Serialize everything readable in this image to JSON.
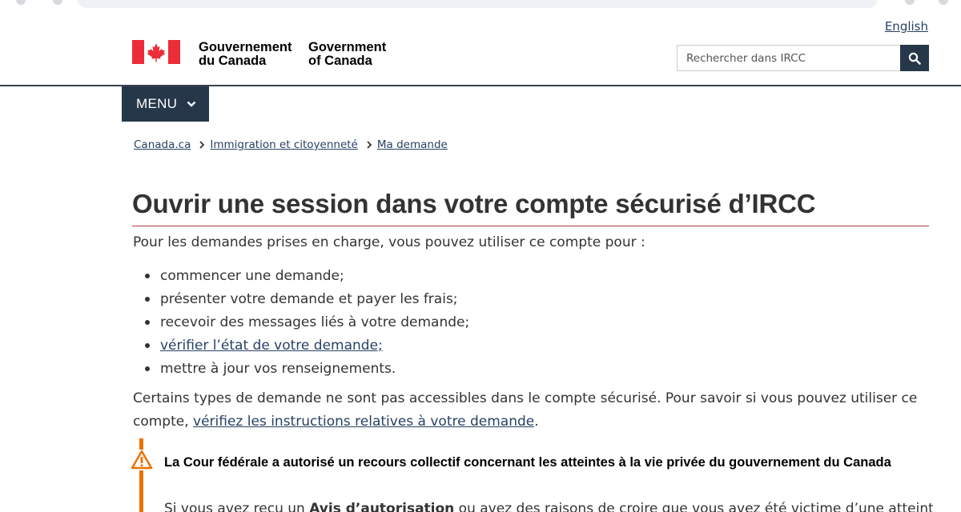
{
  "header": {
    "language_link": "English",
    "wordmark_fr_line1": "Gouvernement",
    "wordmark_fr_line2": "du Canada",
    "wordmark_en_line1": "Government",
    "wordmark_en_line2": "of Canada",
    "search_placeholder": "Rechercher dans IRCC",
    "menu_label": "MENU",
    "icons": [
      "canada-flag-icon",
      "search-icon",
      "chevron-down-icon"
    ],
    "colors": {
      "nav": "#26374a",
      "flag_red": "#eb2d37",
      "link": "#284162",
      "title_rule": "#af3c43",
      "warning": "#ee7100"
    }
  },
  "breadcrumb": [
    "Canada.ca",
    "Immigration et citoyenneté",
    "Ma demande"
  ],
  "main": {
    "title": "Ouvrir une session dans votre compte sécurisé d’IRCC",
    "intro": "Pour les demandes prises en charge, vous pouvez utiliser ce compte pour :",
    "bullets": [
      "commencer une demande;",
      "présenter votre demande et payer les frais;",
      "recevoir des messages liés à votre demande;",
      "vérifier l’état de votre demande;",
      "mettre à jour vos renseignements."
    ],
    "para_text": "Certains types de demande ne sont pas accessibles dans le compte sécurisé. Pour savoir si vous pouvez utiliser ce compte, ",
    "para_link": "vérifiez les instructions relatives à votre demande",
    "para_end": "."
  },
  "alert": {
    "heading": "La Cour fédérale a autorisé un recours collectif concernant les atteintes à la vie privée du gouvernement du Canada",
    "body_start": "Si vous avez reçu un ",
    "body_bold": "Avis d’autorisation",
    "body_rest": " ou avez des raisons de croire que vous avez été victime d’une atteinte à la"
  }
}
